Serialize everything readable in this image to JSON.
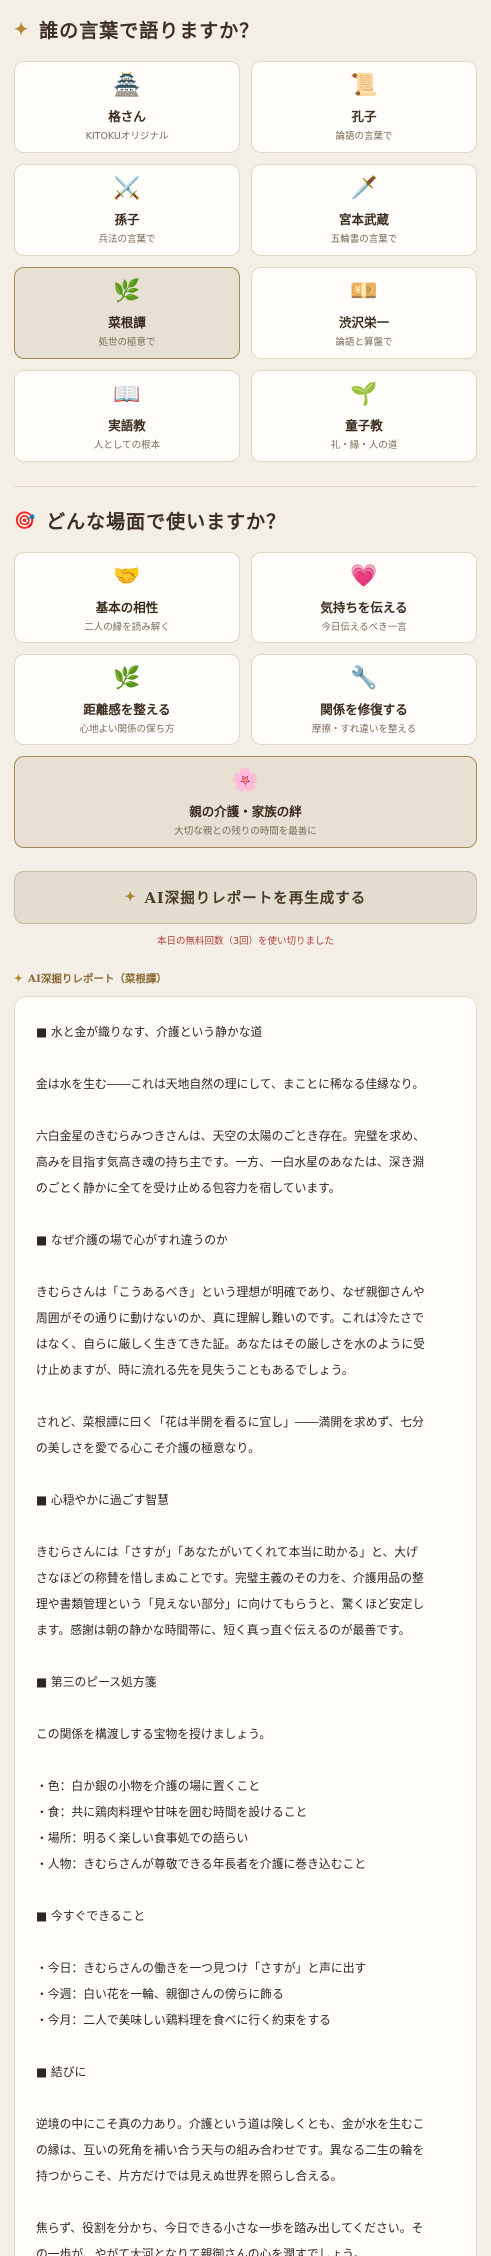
{
  "section1": {
    "icon": "✦",
    "title": "誰の言葉で語りますか？",
    "speakers": [
      {
        "emoji": "🏯",
        "icon_name": "castle-icon",
        "name": "格さん",
        "sub": "KITOKUオリジナル",
        "selected": false
      },
      {
        "emoji": "📜",
        "icon_name": "scroll-icon",
        "name": "孔子",
        "sub": "論語の言葉で",
        "selected": false
      },
      {
        "emoji": "⚔️",
        "icon_name": "crossed-swords-icon",
        "name": "孫子",
        "sub": "兵法の言葉で",
        "selected": false
      },
      {
        "emoji": "🗡️",
        "icon_name": "dagger-icon",
        "name": "宮本武蔵",
        "sub": "五輪書の言葉で",
        "selected": false
      },
      {
        "emoji": "🌿",
        "icon_name": "herb-icon",
        "name": "菜根譚",
        "sub": "処世の極意で",
        "selected": true
      },
      {
        "emoji": "💴",
        "icon_name": "banknote-icon",
        "name": "渋沢栄一",
        "sub": "論語と算盤で",
        "selected": false
      },
      {
        "emoji": "📖",
        "icon_name": "open-book-icon",
        "name": "実語教",
        "sub": "人としての根本",
        "selected": false
      },
      {
        "emoji": "🌱",
        "icon_name": "seedling-icon",
        "name": "童子教",
        "sub": "礼・縁・人の道",
        "selected": false
      }
    ]
  },
  "section2": {
    "icon": "🎯",
    "title": "どんな場面で使いますか？",
    "scenes": [
      {
        "emoji": "🤝",
        "icon_name": "handshake-icon",
        "name": "基本の相性",
        "sub": "二人の縁を読み解く",
        "selected": false
      },
      {
        "emoji": "💗",
        "icon_name": "heart-icon",
        "name": "気持ちを伝える",
        "sub": "今日伝えるべき一言",
        "selected": false
      },
      {
        "emoji": "🌿",
        "icon_name": "herb-icon",
        "name": "距離感を整える",
        "sub": "心地よい関係の保ち方",
        "selected": false
      },
      {
        "emoji": "🔧",
        "icon_name": "wrench-icon",
        "name": "関係を修復する",
        "sub": "摩擦・すれ違いを整える",
        "selected": false
      }
    ],
    "wide": {
      "emoji": "🌸",
      "icon_name": "blossom-icon",
      "name": "親の介護・家族の絆",
      "sub": "大切な親との残りの時間を最善に",
      "selected": true
    }
  },
  "regen_button": {
    "icon": "✦",
    "label": "AI深掘りレポートを再生成する"
  },
  "notice": "本日の無料回数（3回）を使い切りました",
  "report_label": {
    "icon": "✦",
    "text": "AI深掘りレポート（菜根譚）"
  },
  "report_lines": [
    "■ 水と金が織りなす、介護という静かな道",
    "",
    "金は水を生む――これは天地自然の理にして、まことに稀なる佳縁なり。",
    "",
    "六白金星のきむらみつきさんは、天空の太陽のごとき存在。完璧を求め、",
    "高みを目指す気高き魂の持ち主です。一方、一白水星のあなたは、深き淵",
    "のごとく静かに全てを受け止める包容力を宿しています。",
    "",
    "■ なぜ介護の場で心がすれ違うのか",
    "",
    "きむらさんは「こうあるべき」という理想が明確であり、なぜ親御さんや",
    "周囲がその通りに動けないのか、真に理解し難いのです。これは冷たさで",
    "はなく、自らに厳しく生きてきた証。あなたはその厳しさを水のように受",
    "け止めますが、時に流れる先を見失うこともあるでしょう。",
    "",
    "されど、菜根譚に曰く「花は半開を看るに宜し」――満開を求めず、七分",
    "の美しさを愛でる心こそ介護の極意なり。",
    "",
    "■ 心穏やかに過ごす智慧",
    "",
    "きむらさんには「さすが」「あなたがいてくれて本当に助かる」と、大げ",
    "さなほどの称賛を惜しまぬことです。完璧主義のその力を、介護用品の整",
    "理や書類管理という「見えない部分」に向けてもらうと、驚くほど安定し",
    "ます。感謝は朝の静かな時間帯に、短く真っ直ぐ伝えるのが最善です。",
    "",
    "■ 第三のピース処方箋",
    "",
    "この関係を構渡しする宝物を授けましょう。",
    "",
    "・色：白か銀の小物を介護の場に置くこと",
    "・食：共に鶏肉料理や甘味を囲む時間を設けること",
    "・場所：明るく楽しい食事処での語らい",
    "・人物：きむらさんが尊敬できる年長者を介護に巻き込むこと",
    "",
    "■ 今すぐできること",
    "",
    "・今日：きむらさんの働きを一つ見つけ「さすが」と声に出す",
    "・今週：白い花を一輪、親御さんの傍らに飾る",
    "・今月：二人で美味しい鶏料理を食べに行く約束をする",
    "",
    "■ 結びに",
    "",
    "逆境の中にこそ真の力あり。介護という道は険しくとも、金が水を生むこ",
    "の縁は、互いの死角を補い合う天与の組み合わせです。異なる二生の輪を",
    "持つからこそ、片方だけでは見えぬ世界を照らし合える。",
    "",
    "焦らず、役割を分かち、今日できる小さな一歩を踏み出してください。そ",
    "の一歩が、やがて大河となりて親御さんの心を潤すでしょう。"
  ]
}
